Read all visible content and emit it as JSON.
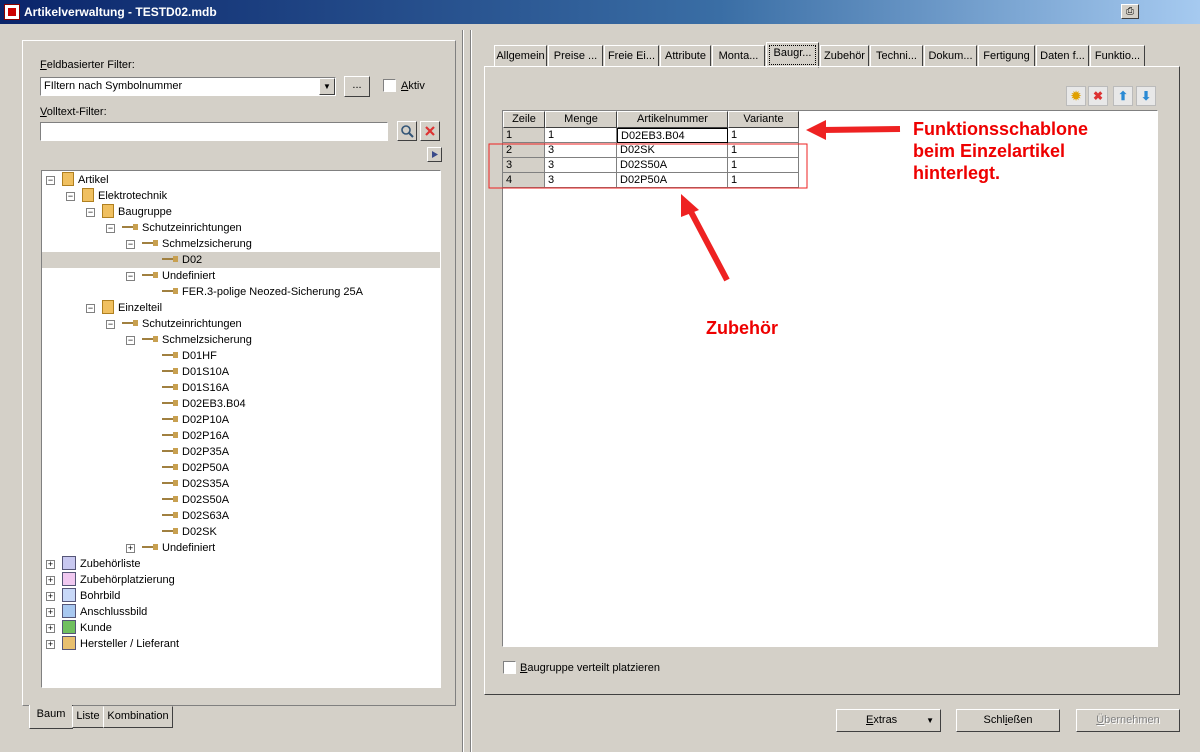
{
  "window": {
    "title": "Artikelverwaltung - TESTD02.mdb"
  },
  "filter": {
    "field_label_first": "F",
    "field_label_rest": "eldbasierter Filter:",
    "combo_value": "FIltern nach Symbolnummer",
    "ellipsis_label": "...",
    "aktiv_first": "A",
    "aktiv_rest": "ktiv",
    "fulltext_first": "V",
    "fulltext_rest": "olltext-Filter:",
    "fulltext_value": ""
  },
  "tree": {
    "nodes": [
      {
        "label": "Artikel",
        "level": 0,
        "icon": "folder-icon",
        "expander": "−"
      },
      {
        "label": "Elektrotechnik",
        "level": 1,
        "icon": "folder-icon",
        "expander": "−"
      },
      {
        "label": "Baugruppe",
        "level": 2,
        "icon": "folder-icon",
        "expander": "−"
      },
      {
        "label": "Schutzeinrichtungen",
        "level": 3,
        "icon": "key-icon",
        "expander": "−"
      },
      {
        "label": "Schmelzsicherung",
        "level": 4,
        "icon": "key-icon",
        "expander": "−"
      },
      {
        "label": "D02",
        "level": 5,
        "icon": "key-icon",
        "expander": "",
        "selected": true
      },
      {
        "label": "Undefiniert",
        "level": 4,
        "icon": "key-icon",
        "expander": "−"
      },
      {
        "label": "FER.3-polige Neozed-Sicherung 25A",
        "level": 5,
        "icon": "key-icon",
        "expander": ""
      },
      {
        "label": "Einzelteil",
        "level": 2,
        "icon": "folder-icon",
        "expander": "−"
      },
      {
        "label": "Schutzeinrichtungen",
        "level": 3,
        "icon": "key-icon",
        "expander": "−"
      },
      {
        "label": "Schmelzsicherung",
        "level": 4,
        "icon": "key-icon",
        "expander": "−"
      },
      {
        "label": "D01HF",
        "level": 5,
        "icon": "key-icon",
        "expander": ""
      },
      {
        "label": "D01S10A",
        "level": 5,
        "icon": "key-icon",
        "expander": ""
      },
      {
        "label": "D01S16A",
        "level": 5,
        "icon": "key-icon",
        "expander": ""
      },
      {
        "label": "D02EB3.B04",
        "level": 5,
        "icon": "key-icon",
        "expander": ""
      },
      {
        "label": "D02P10A",
        "level": 5,
        "icon": "key-icon",
        "expander": ""
      },
      {
        "label": "D02P16A",
        "level": 5,
        "icon": "key-icon",
        "expander": ""
      },
      {
        "label": "D02P35A",
        "level": 5,
        "icon": "key-icon",
        "expander": ""
      },
      {
        "label": "D02P50A",
        "level": 5,
        "icon": "key-icon",
        "expander": ""
      },
      {
        "label": "D02S35A",
        "level": 5,
        "icon": "key-icon",
        "expander": ""
      },
      {
        "label": "D02S50A",
        "level": 5,
        "icon": "key-icon",
        "expander": ""
      },
      {
        "label": "D02S63A",
        "level": 5,
        "icon": "key-icon",
        "expander": ""
      },
      {
        "label": "D02SK",
        "level": 5,
        "icon": "key-icon",
        "expander": ""
      },
      {
        "label": "Undefiniert",
        "level": 4,
        "icon": "key-icon",
        "expander": "+"
      },
      {
        "label": "Zubehörliste",
        "level": 0,
        "icon": "list-icon",
        "expander": "+"
      },
      {
        "label": "Zubehörplatzierung",
        "level": 0,
        "icon": "placement-icon",
        "expander": "+"
      },
      {
        "label": "Bohrbild",
        "level": 0,
        "icon": "drill-icon",
        "expander": "+"
      },
      {
        "label": "Anschlussbild",
        "level": 0,
        "icon": "connection-icon",
        "expander": "+"
      },
      {
        "label": "Kunde",
        "level": 0,
        "icon": "customer-icon",
        "expander": "+"
      },
      {
        "label": "Hersteller / Lieferant",
        "level": 0,
        "icon": "factory-icon",
        "expander": "+"
      }
    ]
  },
  "bottom_tabs": [
    "Baum",
    "Liste",
    "Kombination"
  ],
  "tabs": [
    "Allgemein",
    "Preise ...",
    "Freie Ei...",
    "Attribute",
    "Monta...",
    "Baugr...",
    "Zubehör",
    "Techni...",
    "Dokum...",
    "Fertigung",
    "Daten f...",
    "Funktio..."
  ],
  "active_tab": 5,
  "grid": {
    "columns": [
      "Zeile",
      "Menge",
      "Artikelnummer",
      "Variante"
    ],
    "rows": [
      [
        "1",
        "1",
        "D02EB3.B04",
        "1"
      ],
      [
        "2",
        "3",
        "D02SK",
        "1"
      ],
      [
        "3",
        "3",
        "D02S50A",
        "1"
      ],
      [
        "4",
        "3",
        "D02P50A",
        "1"
      ]
    ]
  },
  "checkbox": {
    "first": "B",
    "rest": "augruppe verteilt platzieren",
    "checked": false
  },
  "buttons": {
    "extras_first": "E",
    "extras_rest": "xtras",
    "close_pre": "Schl",
    "close_u": "i",
    "close_post": "eßen",
    "apply_first": "Ü",
    "apply_rest": "bernehmen"
  },
  "annotations": {
    "line1": "Funktionsschablone",
    "line2": "beim Einzelartikel",
    "line3": "hinterlegt.",
    "zubehoer": "Zubehör"
  },
  "colors": {
    "annotation": "#ee2222",
    "title_bar": "#0a246a"
  }
}
